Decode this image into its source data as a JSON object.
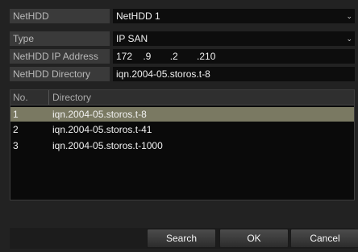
{
  "form": {
    "nethdd": {
      "label": "NetHDD",
      "value": "NetHDD 1"
    },
    "type": {
      "label": "Type",
      "value": "IP SAN"
    },
    "ip": {
      "label": "NetHDD IP Address",
      "octets": [
        "172",
        ".9",
        ".2",
        ".210"
      ]
    },
    "directory": {
      "label": "NetHDD Directory",
      "value": "iqn.2004-05.storos.t-8"
    }
  },
  "table": {
    "headers": {
      "no": "No.",
      "directory": "Directory"
    },
    "rows": [
      {
        "no": "1",
        "directory": "iqn.2004-05.storos.t-8",
        "selected": true
      },
      {
        "no": "2",
        "directory": "iqn.2004-05.storos.t-41",
        "selected": false
      },
      {
        "no": "3",
        "directory": "iqn.2004-05.storos.t-1000",
        "selected": false
      }
    ]
  },
  "buttons": {
    "search": "Search",
    "ok": "OK",
    "cancel": "Cancel"
  },
  "icons": {
    "dropdown": "chevron-down-icon"
  }
}
